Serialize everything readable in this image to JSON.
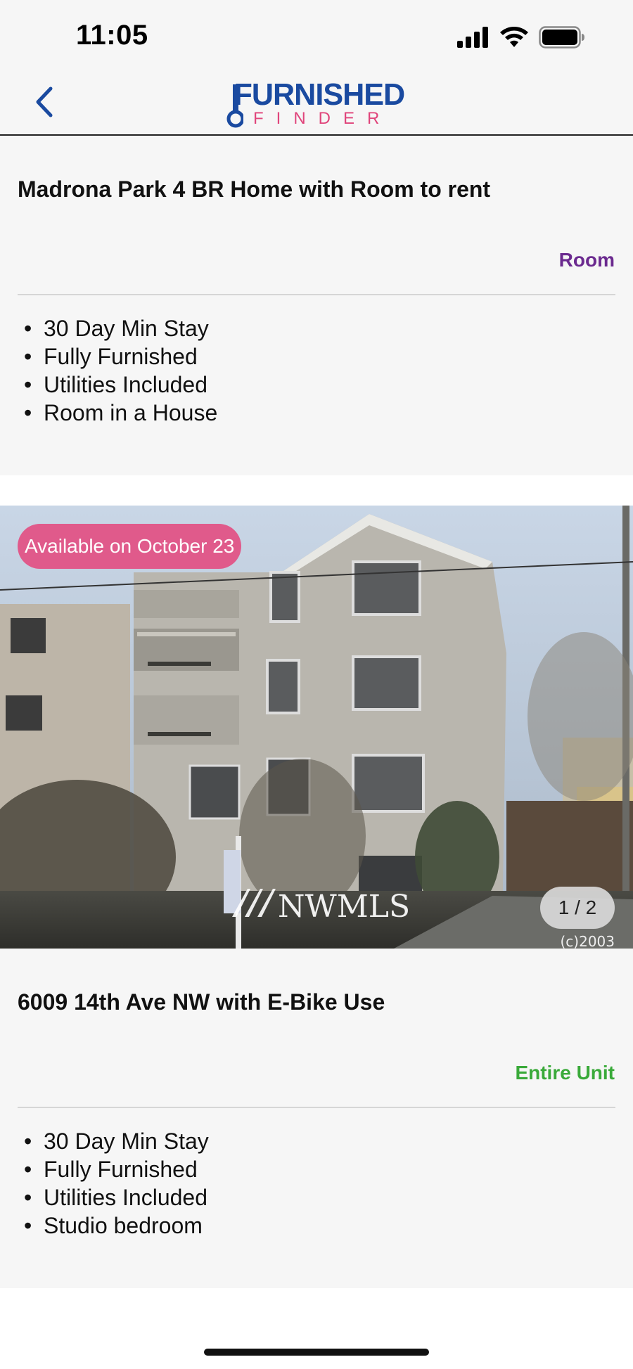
{
  "status_bar": {
    "time": "11:05"
  },
  "nav": {
    "logo_top": "FURNISHED",
    "logo_bottom": "FINDER"
  },
  "listings": [
    {
      "title": "Madrona Park 4 BR Home with Room to rent",
      "type": "Room",
      "type_color": "#6b2a8f",
      "features": [
        "30 Day Min Stay",
        "Fully Furnished",
        "Utilities Included",
        "Room in a House"
      ]
    },
    {
      "badge": "Available on October 23",
      "pager": "1 / 2",
      "watermark": "NWMLS",
      "copyright": "(c)2003",
      "title": "6009 14th Ave NW with E-Bike Use",
      "type": "Entire Unit",
      "type_color": "#3aaa3a",
      "features": [
        "30 Day Min Stay",
        "Fully Furnished",
        "Utilities Included",
        "Studio bedroom"
      ]
    }
  ],
  "colors": {
    "brand_blue": "#1a4aa0",
    "brand_pink": "#e0457b",
    "badge_pink": "#e05a8b"
  },
  "icons": [
    "signal-icon",
    "wifi-icon",
    "battery-icon",
    "back-chevron-icon",
    "key-icon"
  ]
}
